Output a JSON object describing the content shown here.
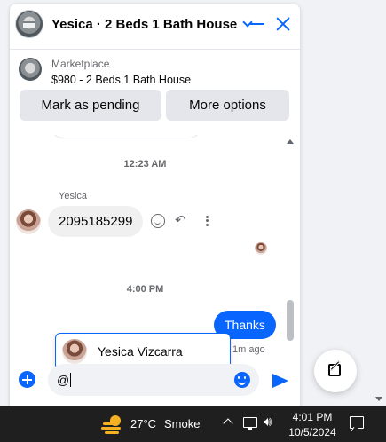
{
  "chat_header": {
    "title": "Yesica · 2 Beds 1 Bath House"
  },
  "listing": {
    "source": "Marketplace",
    "price_title": "$980 - 2 Beds 1 Bath House",
    "mark_pending_label": "Mark as pending",
    "more_options_label": "More options"
  },
  "messages": {
    "timestamp_1": "12:23 AM",
    "sender_name": "Yesica",
    "incoming_text": "2095185299",
    "timestamp_2": "4:00 PM",
    "outgoing_text": "Thanks",
    "outgoing_time": "1m ago"
  },
  "mention_suggestion": {
    "name": "Yesica Vizcarra"
  },
  "composer": {
    "value": "@"
  },
  "taskbar": {
    "temperature": "27°C",
    "weather": "Smoke",
    "time": "4:01 PM",
    "date": "10/5/2024"
  },
  "colors": {
    "accent": "#0866ff",
    "taskbar": "#1f1f1f"
  }
}
